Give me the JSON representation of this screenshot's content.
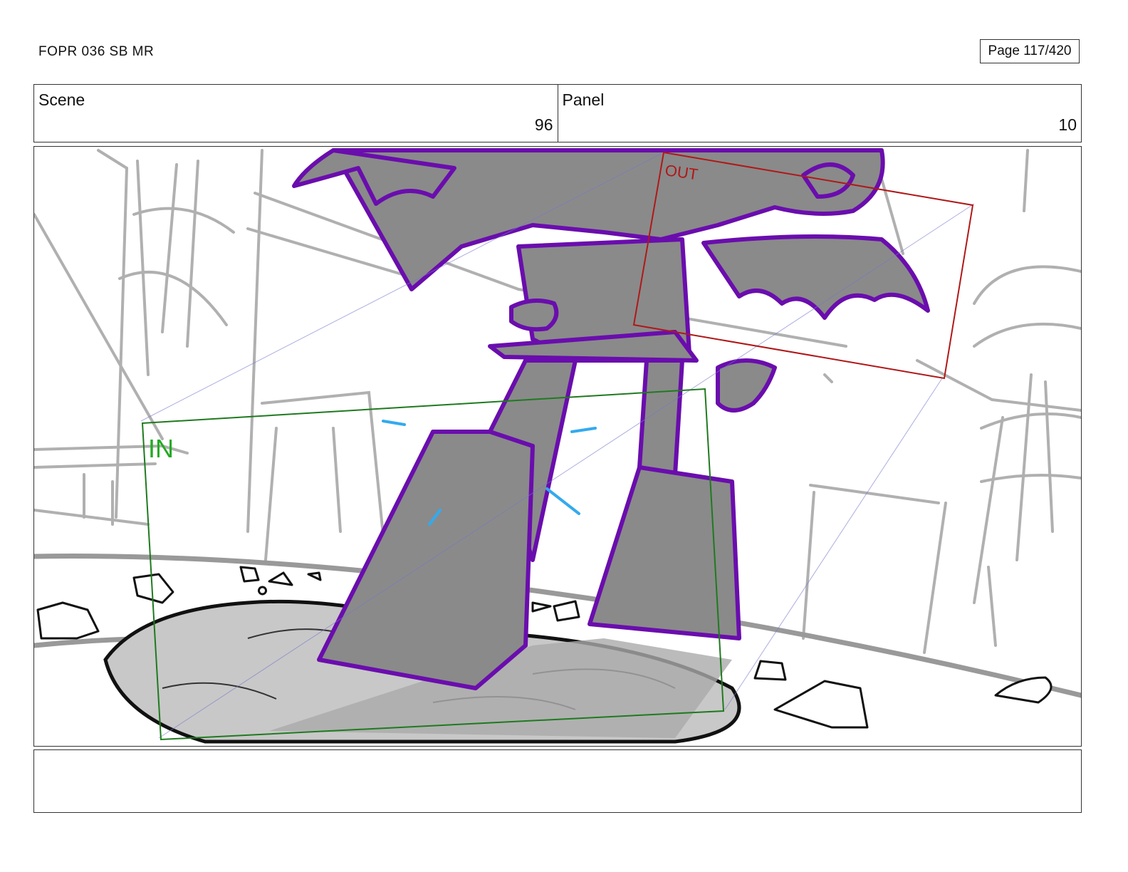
{
  "header": {
    "doc_title": "FOPR 036 SB MR",
    "page_label": "Page 117/420"
  },
  "info": {
    "scene_label": "Scene",
    "scene_value": "96",
    "panel_label": "Panel",
    "panel_value": "10"
  },
  "panel": {
    "in_label": "IN",
    "out_label": "OUT",
    "colors": {
      "in_frame": "#1f7a1f",
      "out_frame": "#b01818",
      "character_outline": "#6a0dad",
      "character_fill": "#8a8a8a",
      "background_lines": "#b0b0b0",
      "debris": "#111111",
      "effects": "#33aaee"
    }
  },
  "notes": {
    "text": ""
  }
}
